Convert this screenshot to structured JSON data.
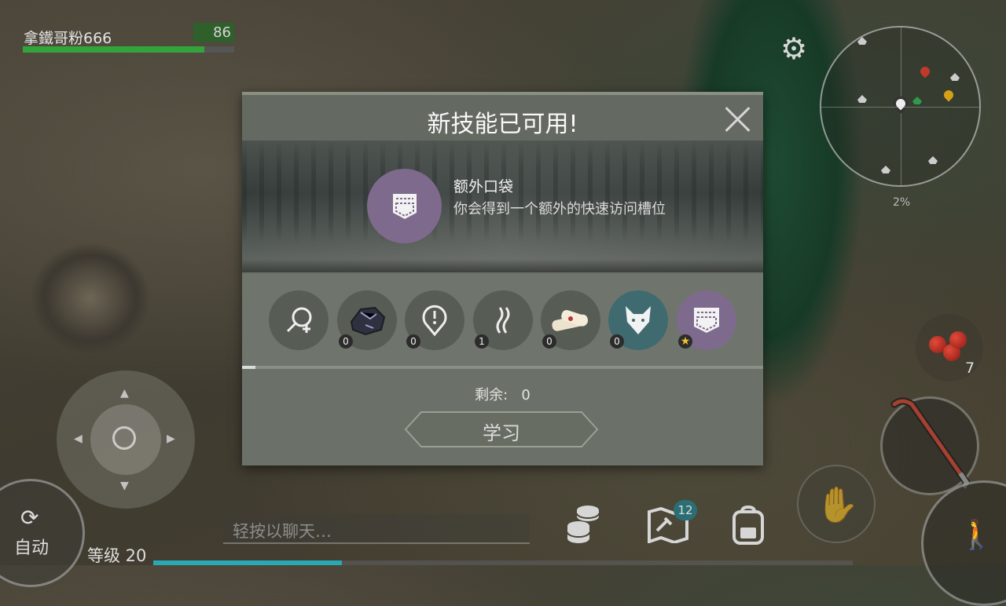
{
  "hud": {
    "player_name": "拿鐵哥粉666",
    "hp_value": "86",
    "hp_fraction": 0.86,
    "minimap_percent": "2%",
    "level_text": "等级 20",
    "xp_fraction": 0.27,
    "auto_label": "自动",
    "chat_placeholder": "轻按以聊天…",
    "map_badge": "12",
    "food_count": "7"
  },
  "dialog": {
    "title": "新技能已可用!",
    "skill_name": "额外口袋",
    "skill_desc": "你会得到一个额外的快速访问槽位",
    "remaining_label": "剩余:",
    "remaining_value": "0",
    "learn_label": "学习",
    "progress_fraction": 0.025,
    "skills": [
      {
        "icon": "magnifier-plus-icon",
        "count": ""
      },
      {
        "icon": "ore-icon",
        "count": "0"
      },
      {
        "icon": "alert-pin-icon",
        "count": "0"
      },
      {
        "icon": "heat-waves-icon",
        "count": "1"
      },
      {
        "icon": "bandage-icon",
        "count": "0"
      },
      {
        "icon": "wolf-icon",
        "count": "0"
      },
      {
        "icon": "pocket-icon",
        "count": "star"
      }
    ]
  },
  "colors": {
    "hp_green": "#33a43c",
    "xp_teal": "#2aa9b5",
    "pocket_purple": "#7e6a8c",
    "wolf_teal": "#3f6b70"
  }
}
